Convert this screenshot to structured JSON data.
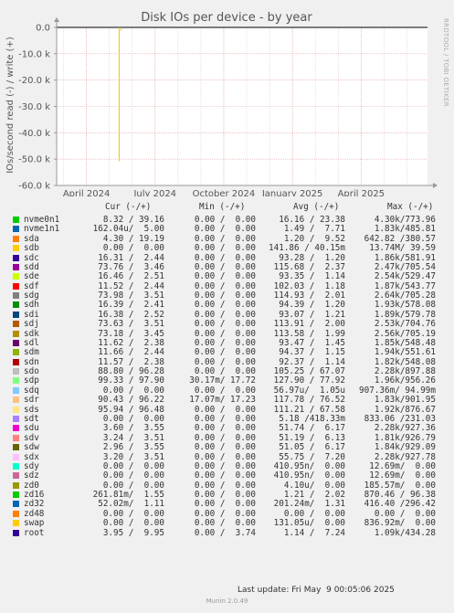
{
  "chart_data": {
    "type": "line",
    "title": "Disk IOs per device - by year",
    "ylabel": "IOs/second read (-) / write (+)",
    "side_label": "RRDTOOL / TOBI OETIKER",
    "ylim": [
      -60,
      0
    ],
    "yticks": [
      "0.0",
      "-10.0 k",
      "-20.0 k",
      "-30.0 k",
      "-40.0 k",
      "-50.0 k",
      "-60.0 k"
    ],
    "ytick_values": [
      0,
      -10,
      -20,
      -30,
      -40,
      -50,
      -60
    ],
    "xticks": [
      "April 2024",
      "July 2024",
      "October 2024",
      "January 2025",
      "April 2025"
    ],
    "x_range_months": [
      -1.3,
      14.9
    ],
    "xtick_months": [
      0,
      3,
      6,
      9,
      12
    ],
    "series": [
      {
        "name": "sdb",
        "color": "#f2c200",
        "x_month": 1.43,
        "y": -50.8
      }
    ],
    "grid": true
  },
  "legend": {
    "headers": {
      "cur": "Cur (-/+)",
      "min": "Min (-/+)",
      "avg": "Avg (-/+)",
      "max": "Max (-/+)"
    },
    "rows": [
      {
        "name": "nvme0n1",
        "color": "#00cc00",
        "cur": "8.32 / 39.16",
        "min": "0.00 /  0.00",
        "avg": "16.16 / 23.38",
        "max": "4.30k/773.96"
      },
      {
        "name": "nvme1n1",
        "color": "#0066b3",
        "cur": "162.04u/  5.00",
        "min": "0.00 /  0.00",
        "avg": "1.49 /  7.71",
        "max": "1.83k/485.81"
      },
      {
        "name": "sda",
        "color": "#ff8000",
        "cur": "4.30 / 19.19",
        "min": "0.00 /  0.00",
        "avg": "1.20 /  9.52",
        "max": "642.82 /380.57"
      },
      {
        "name": "sdb",
        "color": "#ffcc00",
        "cur": "0.00 /  0.00",
        "min": "0.00 /  0.00",
        "avg": "141.86 / 40.15m",
        "max": "13.74M/ 39.59"
      },
      {
        "name": "sdc",
        "color": "#330099",
        "cur": "16.31 /  2.44",
        "min": "0.00 /  0.00",
        "avg": "93.28 /  1.20",
        "max": "1.86k/581.91"
      },
      {
        "name": "sdd",
        "color": "#990099",
        "cur": "73.76 /  3.46",
        "min": "0.00 /  0.00",
        "avg": "115.68 /  2.37",
        "max": "2.47k/705.54"
      },
      {
        "name": "sde",
        "color": "#ccff00",
        "cur": "16.46 /  2.51",
        "min": "0.00 /  0.00",
        "avg": "93.35 /  1.14",
        "max": "2.54k/529.47"
      },
      {
        "name": "sdf",
        "color": "#ff0000",
        "cur": "11.52 /  2.44",
        "min": "0.00 /  0.00",
        "avg": "102.03 /  1.18",
        "max": "1.87k/543.77"
      },
      {
        "name": "sdg",
        "color": "#808080",
        "cur": "73.98 /  3.51",
        "min": "0.00 /  0.00",
        "avg": "114.93 /  2.01",
        "max": "2.64k/705.28"
      },
      {
        "name": "sdh",
        "color": "#008f00",
        "cur": "16.39 /  2.41",
        "min": "0.00 /  0.00",
        "avg": "94.39 /  1.20",
        "max": "1.93k/578.08"
      },
      {
        "name": "sdi",
        "color": "#00487d",
        "cur": "16.38 /  2.52",
        "min": "0.00 /  0.00",
        "avg": "93.07 /  1.21",
        "max": "1.89k/579.78"
      },
      {
        "name": "sdj",
        "color": "#b35a00",
        "cur": "73.63 /  3.51",
        "min": "0.00 /  0.00",
        "avg": "113.91 /  2.00",
        "max": "2.53k/704.76"
      },
      {
        "name": "sdk",
        "color": "#b38f00",
        "cur": "73.18 /  3.45",
        "min": "0.00 /  0.00",
        "avg": "113.58 /  1.99",
        "max": "2.56k/705.19"
      },
      {
        "name": "sdl",
        "color": "#6b006b",
        "cur": "11.62 /  2.38",
        "min": "0.00 /  0.00",
        "avg": "93.47 /  1.45",
        "max": "1.85k/548.48"
      },
      {
        "name": "sdm",
        "color": "#8fb300",
        "cur": "11.66 /  2.44",
        "min": "0.00 /  0.00",
        "avg": "94.37 /  1.15",
        "max": "1.94k/551.61"
      },
      {
        "name": "sdn",
        "color": "#b30000",
        "cur": "11.57 /  2.38",
        "min": "0.00 /  0.00",
        "avg": "92.37 /  1.14",
        "max": "1.82k/548.08"
      },
      {
        "name": "sdo",
        "color": "#bebebe",
        "cur": "88.80 / 96.28",
        "min": "0.00 /  0.00",
        "avg": "105.25 / 67.07",
        "max": "2.28k/897.88"
      },
      {
        "name": "sdp",
        "color": "#80ff80",
        "cur": "99.33 / 97.90",
        "min": "30.17m/ 17.72",
        "avg": "127.90 / 77.92",
        "max": "1.96k/956.26"
      },
      {
        "name": "sdq",
        "color": "#80c9ff",
        "cur": "0.00 /  0.00",
        "min": "0.00 /  0.00",
        "avg": "56.97u/  1.05u",
        "max": "907.36m/ 94.99m"
      },
      {
        "name": "sdr",
        "color": "#ffc080",
        "cur": "90.43 / 96.22",
        "min": "17.07m/ 17.23",
        "avg": "117.78 / 76.52",
        "max": "1.83k/901.95"
      },
      {
        "name": "sds",
        "color": "#ffe680",
        "cur": "95.94 / 96.48",
        "min": "0.00 /  0.00",
        "avg": "111.21 / 67.58",
        "max": "1.92k/876.67"
      },
      {
        "name": "sdt",
        "color": "#aa80ff",
        "cur": "0.00 /  0.00",
        "min": "0.00 /  0.00",
        "avg": "5.18 /418.33m",
        "max": "833.06 /231.03"
      },
      {
        "name": "sdu",
        "color": "#ee00cc",
        "cur": "3.60 /  3.55",
        "min": "0.00 /  0.00",
        "avg": "51.74 /  6.17",
        "max": "2.28k/927.36"
      },
      {
        "name": "sdv",
        "color": "#ff8080",
        "cur": "3.24 /  3.51",
        "min": "0.00 /  0.00",
        "avg": "51.19 /  6.13",
        "max": "1.81k/926.79"
      },
      {
        "name": "sdw",
        "color": "#666600",
        "cur": "2.96 /  3.55",
        "min": "0.00 /  0.00",
        "avg": "51.05 /  6.17",
        "max": "1.84k/929.09"
      },
      {
        "name": "sdx",
        "color": "#ffbfff",
        "cur": "3.20 /  3.51",
        "min": "0.00 /  0.00",
        "avg": "55.75 /  7.20",
        "max": "2.28k/927.78"
      },
      {
        "name": "sdy",
        "color": "#00ffcc",
        "cur": "0.00 /  0.00",
        "min": "0.00 /  0.00",
        "avg": "410.95n/  0.00",
        "max": "12.69m/  0.00"
      },
      {
        "name": "sdz",
        "color": "#cc6699",
        "cur": "0.00 /  0.00",
        "min": "0.00 /  0.00",
        "avg": "410.95n/  0.00",
        "max": "12.69m/  0.00"
      },
      {
        "name": "zd0",
        "color": "#999900",
        "cur": "0.00 /  0.00",
        "min": "0.00 /  0.00",
        "avg": "4.10u/  0.00",
        "max": "185.57m/  0.00"
      },
      {
        "name": "zd16",
        "color": "#00cc00",
        "cur": "261.81m/  1.55",
        "min": "0.00 /  0.00",
        "avg": "1.21 /  2.02",
        "max": "870.46 / 96.38"
      },
      {
        "name": "zd32",
        "color": "#0066b3",
        "cur": "52.02m/  1.11",
        "min": "0.00 /  0.00",
        "avg": "201.24m/  1.31",
        "max": "416.40 /296.42"
      },
      {
        "name": "zd48",
        "color": "#ff8000",
        "cur": "0.00 /  0.00",
        "min": "0.00 /  0.00",
        "avg": "0.00 /  0.00",
        "max": "0.00 /  0.00"
      },
      {
        "name": "swap",
        "color": "#ffcc00",
        "cur": "0.00 /  0.00",
        "min": "0.00 /  0.00",
        "avg": "131.05u/  0.00",
        "max": "836.92m/  0.00"
      },
      {
        "name": "root",
        "color": "#330099",
        "cur": "3.95 /  9.95",
        "min": "0.00 /  3.74",
        "avg": "1.14 /  7.24",
        "max": "1.09k/434.28"
      }
    ]
  },
  "footer": {
    "last_update": "Last update: Fri May  9 00:05:06 2025",
    "munin": "Munin 2.0.49"
  }
}
